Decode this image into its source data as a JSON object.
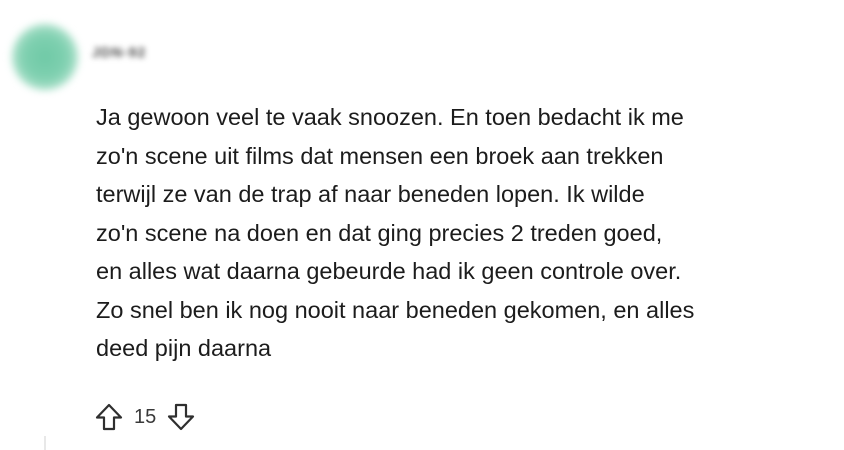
{
  "comment": {
    "author": "JDN-92",
    "body_lines": [
      "Ja gewoon veel te vaak snoozen. En toen bedacht ik me",
      "zo'n scene uit films dat mensen een broek aan trekken",
      "terwijl ze van de trap af naar beneden lopen. Ik wilde",
      "zo'n scene na doen en dat ging precies 2 treden goed,",
      "en alles wat daarna gebeurde had ik geen controle over.",
      "Zo snel ben ik nog nooit naar beneden gekomen, en alles",
      "deed pijn daarna"
    ],
    "score": "15",
    "upvote_icon": "arrow-up-outline-icon",
    "downvote_icon": "arrow-down-outline-icon",
    "avatar_color": "#7fd0b0"
  }
}
